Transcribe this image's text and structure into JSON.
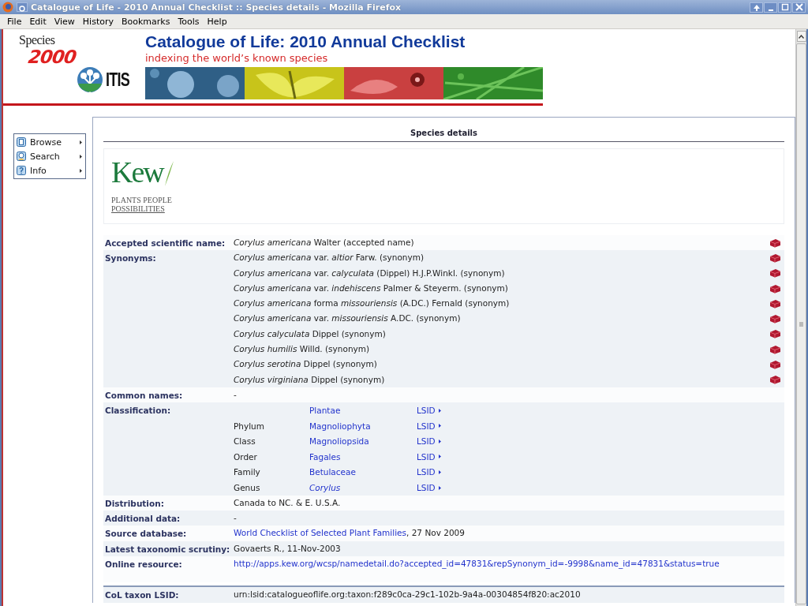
{
  "window": {
    "title": "Catalogue of Life - 2010 Annual Checklist :: Species details - Mozilla Firefox"
  },
  "menu_bar": [
    {
      "label": "File"
    },
    {
      "label": "Edit"
    },
    {
      "label": "View"
    },
    {
      "label": "History"
    },
    {
      "label": "Bookmarks"
    },
    {
      "label": "Tools"
    },
    {
      "label": "Help"
    }
  ],
  "header": {
    "species2000_logo": {
      "word": "Species",
      "number": "2000"
    },
    "itis_logo": "ITIS",
    "title": "Catalogue of Life: 2010 Annual Checklist",
    "subtitle": "indexing the world’s known species"
  },
  "side_menu": [
    {
      "label": "Browse",
      "kind": "browse"
    },
    {
      "label": "Search",
      "kind": "search"
    },
    {
      "label": "Info",
      "kind": "info"
    }
  ],
  "panel": {
    "title": "Species details",
    "source_logo": {
      "wordmark": "Kew",
      "tagline": [
        "PLANTS PEOPLE",
        "POSSIBILITIES"
      ]
    },
    "details": [
      {
        "kind": "names",
        "label": "Accepted scientific name:",
        "names": [
          "*Corylus americana* Walter (accepted name)"
        ]
      },
      {
        "kind": "names",
        "label": "Synonyms:",
        "names": [
          "*Corylus americana* var. *altior* Farw. (synonym)",
          "*Corylus americana* var. *calyculata* (Dippel) H.J.P.Winkl. (synonym)",
          "*Corylus americana* var. *indehiscens* Palmer & Steyerm. (synonym)",
          "*Corylus americana* forma *missouriensis* (A.DC.) Fernald (synonym)",
          "*Corylus americana* var. *missouriensis* A.DC. (synonym)",
          "*Corylus calyculata* Dippel (synonym)",
          "*Corylus humilis* Willd. (synonym)",
          "*Corylus serotina* Dippel (synonym)",
          "*Corylus virginiana* Dippel (synonym)"
        ]
      },
      {
        "kind": "text",
        "label": "Common names:",
        "text": "-"
      },
      {
        "kind": "classification",
        "label": "Classification:",
        "ranks": [
          {
            "taxon": "Plantae",
            "lsid": "LSID",
            "italic": false
          },
          {
            "rank": "Phylum",
            "taxon": "Magnoliophyta",
            "lsid": "LSID",
            "italic": false
          },
          {
            "rank": "Class",
            "taxon": "Magnoliopsida",
            "lsid": "LSID",
            "italic": false
          },
          {
            "rank": "Order",
            "taxon": "Fagales",
            "lsid": "LSID",
            "italic": false
          },
          {
            "rank": "Family",
            "taxon": "Betulaceae",
            "lsid": "LSID",
            "italic": false
          },
          {
            "rank": "Genus",
            "taxon": "Corylus",
            "lsid": "LSID",
            "italic": true
          }
        ]
      },
      {
        "kind": "text",
        "label": "Distribution:",
        "text": "Canada to NC. & E. U.S.A."
      },
      {
        "kind": "text",
        "label": "Additional data:",
        "text": "-"
      },
      {
        "kind": "link",
        "label": "Source database:",
        "link": "World Checklist of Selected Plant Families",
        "text": ", 27 Nov 2009"
      },
      {
        "kind": "text",
        "label": "Latest taxonomic scrutiny:",
        "text": "Govaerts R., 11-Nov-2003"
      },
      {
        "kind": "link",
        "label": "Online resource:",
        "link": "http://apps.kew.org/wcsp/namedetail.do?accepted_id=47831&repSynonym_id=-9998&name_id=47831&status=true"
      }
    ],
    "footer_details": [
      {
        "kind": "text",
        "label": "CoL taxon LSID:",
        "text": "urn:lsid:catalogueoflife.org:taxon:f289c0ca-29c1-102b-9a4a-00304854f820:ac2010"
      }
    ]
  }
}
